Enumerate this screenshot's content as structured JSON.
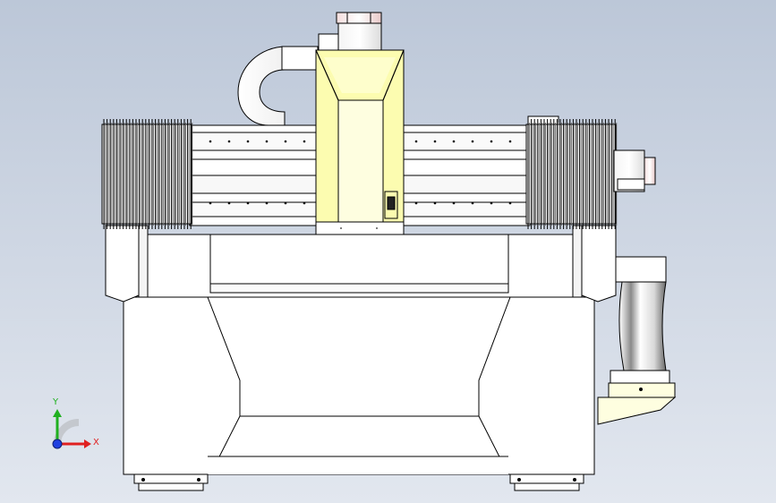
{
  "viewport": {
    "background_top": "#bcc7d8",
    "background_bottom": "#e2e7ef"
  },
  "model": {
    "line_color": "#000000",
    "body_fill": "#ffffff",
    "spindle_fill": "#fcfcb0",
    "spindle_highlight": "#fefee0",
    "bellows_fill": "#ffffff"
  },
  "triad": {
    "x_label": "X",
    "y_label": "Y",
    "x_color": "#e02020",
    "y_color": "#20b020",
    "z_color": "#2040e0"
  }
}
